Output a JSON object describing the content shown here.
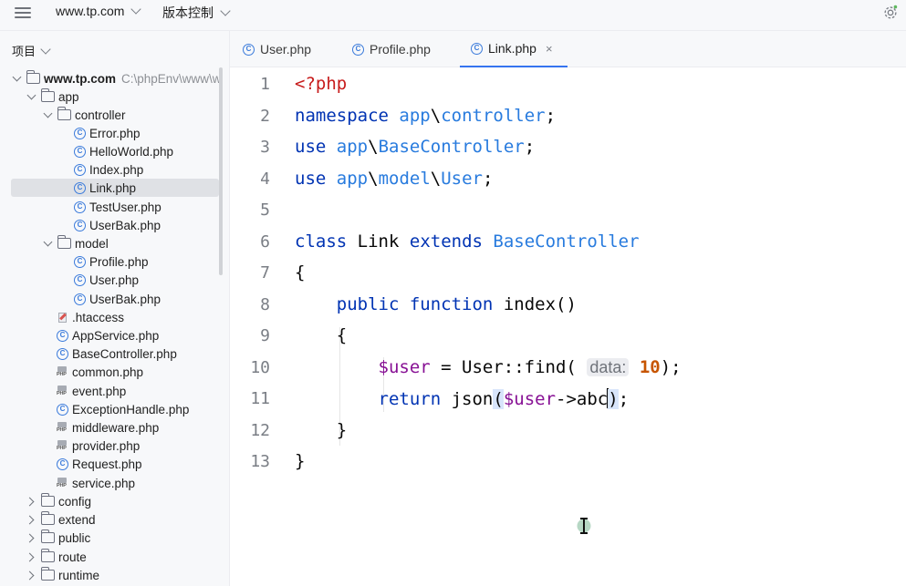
{
  "topbar": {
    "project": "www.tp.com",
    "vcs": "版本控制"
  },
  "sidebar": {
    "title": "项目",
    "root": {
      "label": "www.tp.com",
      "path": "C:\\phpEnv\\www\\w"
    },
    "items": [
      {
        "label": "app"
      },
      {
        "label": "controller"
      },
      {
        "label": "Error.php"
      },
      {
        "label": "HelloWorld.php"
      },
      {
        "label": "Index.php"
      },
      {
        "label": "Link.php"
      },
      {
        "label": "TestUser.php"
      },
      {
        "label": "UserBak.php"
      },
      {
        "label": "model"
      },
      {
        "label": "Profile.php"
      },
      {
        "label": "User.php"
      },
      {
        "label": "UserBak.php"
      },
      {
        "label": ".htaccess"
      },
      {
        "label": "AppService.php"
      },
      {
        "label": "BaseController.php"
      },
      {
        "label": "common.php"
      },
      {
        "label": "event.php"
      },
      {
        "label": "ExceptionHandle.php"
      },
      {
        "label": "middleware.php"
      },
      {
        "label": "provider.php"
      },
      {
        "label": "Request.php"
      },
      {
        "label": "service.php"
      },
      {
        "label": "config"
      },
      {
        "label": "extend"
      },
      {
        "label": "public"
      },
      {
        "label": "route"
      },
      {
        "label": "runtime"
      }
    ]
  },
  "tabs": [
    {
      "label": "User.php"
    },
    {
      "label": "Profile.php"
    },
    {
      "label": "Link.php",
      "close": "×"
    }
  ],
  "editor": {
    "line_numbers": [
      "1",
      "2",
      "3",
      "4",
      "5",
      "6",
      "7",
      "8",
      "9",
      "10",
      "11",
      "12",
      "13"
    ],
    "tokens": {
      "l1_tag": "<?php",
      "l2_kw": "namespace",
      "l2_ns1": "app",
      "l2_sep": "\\",
      "l2_ns2": "controller",
      "l2_end": ";",
      "l3_kw": "use",
      "l3_ns": "app",
      "l3_sep": "\\",
      "l3_cls": "BaseController",
      "l3_end": ";",
      "l4_kw": "use",
      "l4_ns1": "app",
      "l4_sep1": "\\",
      "l4_ns2": "model",
      "l4_sep2": "\\",
      "l4_cls": "User",
      "l4_end": ";",
      "l6_kw1": "class",
      "l6_name": "Link",
      "l6_kw2": "extends",
      "l6_cls": "BaseController",
      "l7": "{",
      "l8_kw1": "public",
      "l8_kw2": "function",
      "l8_name": "index()",
      "l9": "{",
      "l10_var": "$user",
      "l10_op": " = ",
      "l10_call": "User::find(",
      "l10_hint": "data:",
      "l10_num": "10",
      "l10_end": ");",
      "l11_kw": "return",
      "l11_fn": "json",
      "l11_open": "(",
      "l11_var": "$user",
      "l11_arrow": "->",
      "l11_prop": "abc",
      "l11_close": ")",
      "l11_end": ";",
      "l12": "}",
      "l13": "}"
    }
  },
  "colors": {
    "accent": "#3574f0",
    "keyword": "#0033b3",
    "php_tag": "#c71b1b",
    "variable": "#871094",
    "number": "#c75500",
    "class_ref": "#287bde"
  },
  "icons": [
    "hamburger-menu-icon",
    "settings-icon",
    "folder-icon",
    "php-class-icon",
    "php-file-icon",
    "htaccess-file-icon",
    "text-cursor-icon"
  ]
}
